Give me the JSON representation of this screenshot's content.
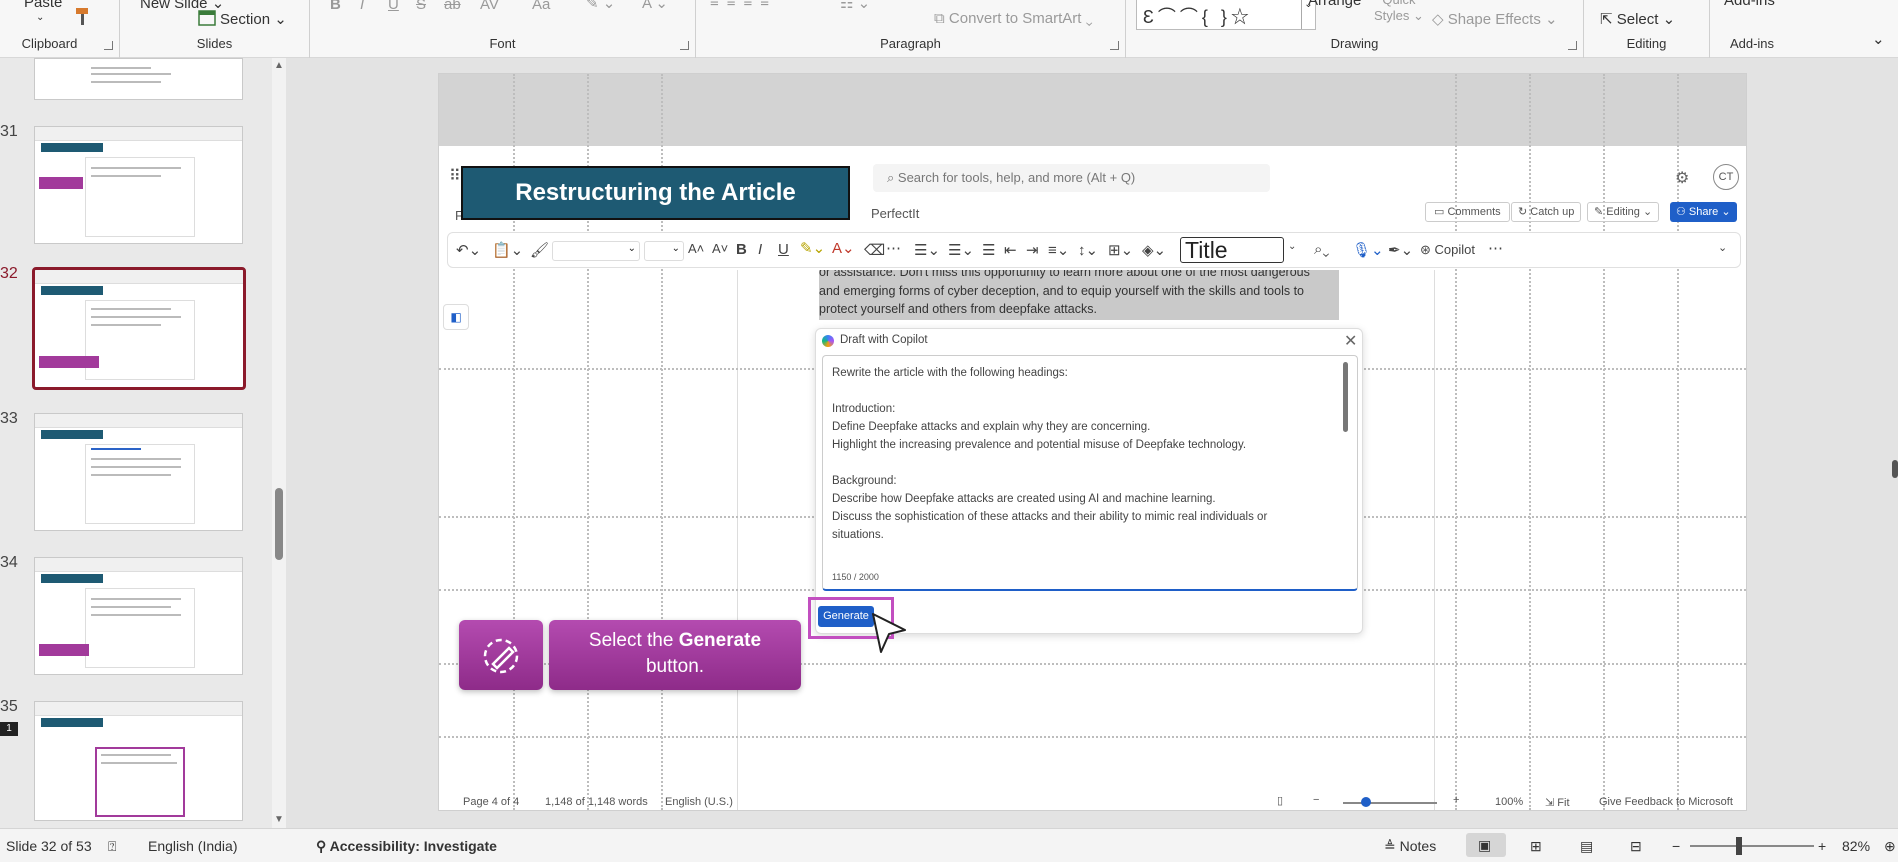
{
  "ribbon": {
    "clipboard": {
      "paste": "Paste",
      "label": "Clipboard"
    },
    "slides": {
      "new_slide": "New Slide",
      "section": "Section",
      "label": "Slides"
    },
    "font": {
      "label": "Font",
      "bold": "B",
      "italic": "I",
      "underline": "U",
      "strike": "S",
      "abc": "ab",
      "spacing": "AV",
      "case": "Aa"
    },
    "paragraph": {
      "label": "Paragraph",
      "convert_smartart": "Convert to SmartArt"
    },
    "drawing": {
      "label": "Drawing",
      "arrange": "Arrange",
      "quick_styles": "Quick Styles",
      "shape_effects": "Shape Effects"
    },
    "editing": {
      "label": "Editing",
      "select": "Select"
    },
    "addins": {
      "label": "Add-ins",
      "add_ins": "Add-ins"
    }
  },
  "thumbnails": [
    {
      "num": "31",
      "title": "Restructuring the Article"
    },
    {
      "num": "32",
      "title": "Restructuring the Article",
      "selected": true
    },
    {
      "num": "33",
      "title": "Restructuring the Article",
      "heading": "How to Protect Yourself"
    },
    {
      "num": "34",
      "title": "Restructuring the Article"
    },
    {
      "num": "35",
      "title": "Shortening Lengthy Text",
      "badge": "1"
    }
  ],
  "slide": {
    "title": "Restructuring the Article",
    "word": {
      "search_placeholder": "Search for tools, help, and more (Alt + Q)",
      "avatar": "CT",
      "tab_perfectit": "PerfectIt",
      "tab_file": "F",
      "comments": "Comments",
      "catch_up": "Catch up",
      "editing": "Editing",
      "share": "Share",
      "style_box": "Title",
      "copilot": "Copilot",
      "doc_text": [
        "or assistance. Don't miss this opportunity to learn more about one of the most dangerous",
        "and emerging forms of cyber deception, and to equip yourself with the skills and tools to",
        "protect yourself and others from deepfake attacks."
      ],
      "draft": {
        "title": "Draft with Copilot",
        "lines": [
          "Rewrite the article with the following headings:",
          "",
          "Introduction:",
          "Define Deepfake attacks and explain why they are concerning.",
          "Highlight the increasing prevalence and potential misuse of Deepfake technology.",
          "",
          "Background:",
          "Describe how Deepfake attacks are created using AI and machine learning.",
          "Discuss the sophistication of these attacks and their ability to mimic real individuals or",
          "situations."
        ],
        "counter": "1150 / 2000",
        "generate": "Generate"
      },
      "statusbar": {
        "page": "Page 4 of 4",
        "words": "1,148 of 1,148 words",
        "lang": "English (U.S.)",
        "zoom": "100%",
        "fit": "Fit",
        "feedback": "Give Feedback to Microsoft"
      }
    },
    "callout": {
      "pre": "Select the ",
      "bold": "Generate",
      "post": " button."
    }
  },
  "status": {
    "slide": "Slide 32 of 53",
    "lang": "English (India)",
    "accessibility": "Accessibility: Investigate",
    "notes": "Notes",
    "zoom": "82%"
  },
  "colors": {
    "accent": "#1e5a73",
    "callout": "#a23a9b",
    "selected": "#8b1a2b",
    "share": "#1f5fc8"
  }
}
